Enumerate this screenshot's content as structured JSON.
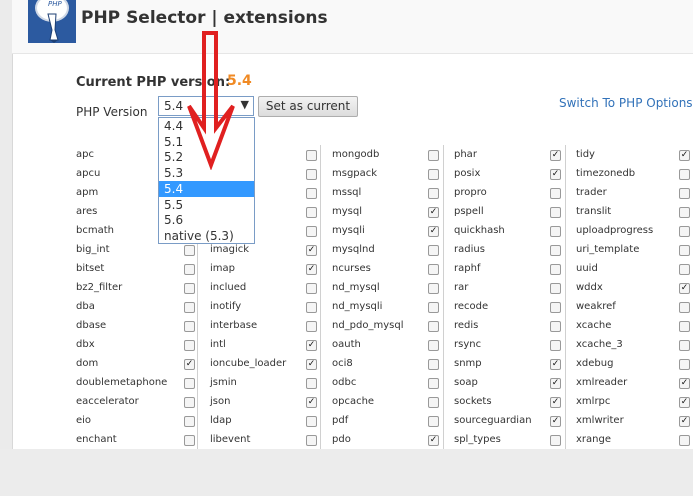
{
  "header": {
    "title": "PHP Selector | extensions",
    "logo_text": "PHP"
  },
  "current": {
    "label": "Current PHP version:",
    "value": "5.4"
  },
  "version_select": {
    "label": "PHP Version",
    "value": "5.4",
    "options": [
      "4.4",
      "5.1",
      "5.2",
      "5.3",
      "5.4",
      "5.5",
      "5.6",
      "native (5.3)"
    ],
    "selected_index": 4
  },
  "set_button": "Set as current",
  "switch_link": "Switch To PHP Options",
  "colors": {
    "accent_orange": "#f08a24",
    "link_blue": "#3272b9",
    "select_blue": "#3399ff",
    "arrow_red": "#e02020"
  },
  "extensions": [
    [
      {
        "name": "apc",
        "checked": false
      },
      {
        "name": "apcu",
        "checked": false
      },
      {
        "name": "apm",
        "checked": false
      },
      {
        "name": "ares",
        "checked": false
      },
      {
        "name": "bcmath",
        "checked": false
      },
      {
        "name": "big_int",
        "checked": false
      },
      {
        "name": "bitset",
        "checked": false
      },
      {
        "name": "bz2_filter",
        "checked": false
      },
      {
        "name": "dba",
        "checked": false
      },
      {
        "name": "dbase",
        "checked": false
      },
      {
        "name": "dbx",
        "checked": false
      },
      {
        "name": "dom",
        "checked": true
      },
      {
        "name": "doublemetaphone",
        "checked": false
      },
      {
        "name": "eaccelerator",
        "checked": false
      },
      {
        "name": "eio",
        "checked": false
      },
      {
        "name": "enchant",
        "checked": false
      }
    ],
    [
      {
        "name": "",
        "checked": false
      },
      {
        "name": "",
        "checked": false
      },
      {
        "name": "r",
        "checked": false
      },
      {
        "name": "",
        "checked": false
      },
      {
        "name": "",
        "checked": false
      },
      {
        "name": "imagick",
        "checked": true
      },
      {
        "name": "imap",
        "checked": true
      },
      {
        "name": "inclued",
        "checked": false
      },
      {
        "name": "inotify",
        "checked": false
      },
      {
        "name": "interbase",
        "checked": false
      },
      {
        "name": "intl",
        "checked": true
      },
      {
        "name": "ioncube_loader",
        "checked": true
      },
      {
        "name": "jsmin",
        "checked": false
      },
      {
        "name": "json",
        "checked": true
      },
      {
        "name": "ldap",
        "checked": false
      },
      {
        "name": "libevent",
        "checked": false
      }
    ],
    [
      {
        "name": "mongodb",
        "checked": false
      },
      {
        "name": "msgpack",
        "checked": false
      },
      {
        "name": "mssql",
        "checked": false
      },
      {
        "name": "mysql",
        "checked": true
      },
      {
        "name": "mysqli",
        "checked": true
      },
      {
        "name": "mysqlnd",
        "checked": false
      },
      {
        "name": "ncurses",
        "checked": false
      },
      {
        "name": "nd_mysql",
        "checked": false
      },
      {
        "name": "nd_mysqli",
        "checked": false
      },
      {
        "name": "nd_pdo_mysql",
        "checked": false
      },
      {
        "name": "oauth",
        "checked": false
      },
      {
        "name": "oci8",
        "checked": false
      },
      {
        "name": "odbc",
        "checked": false
      },
      {
        "name": "opcache",
        "checked": false
      },
      {
        "name": "pdf",
        "checked": false
      },
      {
        "name": "pdo",
        "checked": true
      }
    ],
    [
      {
        "name": "phar",
        "checked": true
      },
      {
        "name": "posix",
        "checked": true
      },
      {
        "name": "propro",
        "checked": false
      },
      {
        "name": "pspell",
        "checked": false
      },
      {
        "name": "quickhash",
        "checked": false
      },
      {
        "name": "radius",
        "checked": false
      },
      {
        "name": "raphf",
        "checked": false
      },
      {
        "name": "rar",
        "checked": false
      },
      {
        "name": "recode",
        "checked": false
      },
      {
        "name": "redis",
        "checked": false
      },
      {
        "name": "rsync",
        "checked": false
      },
      {
        "name": "snmp",
        "checked": true
      },
      {
        "name": "soap",
        "checked": true
      },
      {
        "name": "sockets",
        "checked": true
      },
      {
        "name": "sourceguardian",
        "checked": true
      },
      {
        "name": "spl_types",
        "checked": false
      }
    ],
    [
      {
        "name": "tidy",
        "checked": true
      },
      {
        "name": "timezonedb",
        "checked": false
      },
      {
        "name": "trader",
        "checked": false
      },
      {
        "name": "translit",
        "checked": false
      },
      {
        "name": "uploadprogress",
        "checked": false
      },
      {
        "name": "uri_template",
        "checked": false
      },
      {
        "name": "uuid",
        "checked": false
      },
      {
        "name": "wddx",
        "checked": true
      },
      {
        "name": "weakref",
        "checked": false
      },
      {
        "name": "xcache",
        "checked": false
      },
      {
        "name": "xcache_3",
        "checked": false
      },
      {
        "name": "xdebug",
        "checked": false
      },
      {
        "name": "xmlreader",
        "checked": true
      },
      {
        "name": "xmlrpc",
        "checked": true
      },
      {
        "name": "xmlwriter",
        "checked": true
      },
      {
        "name": "xrange",
        "checked": false
      }
    ]
  ]
}
